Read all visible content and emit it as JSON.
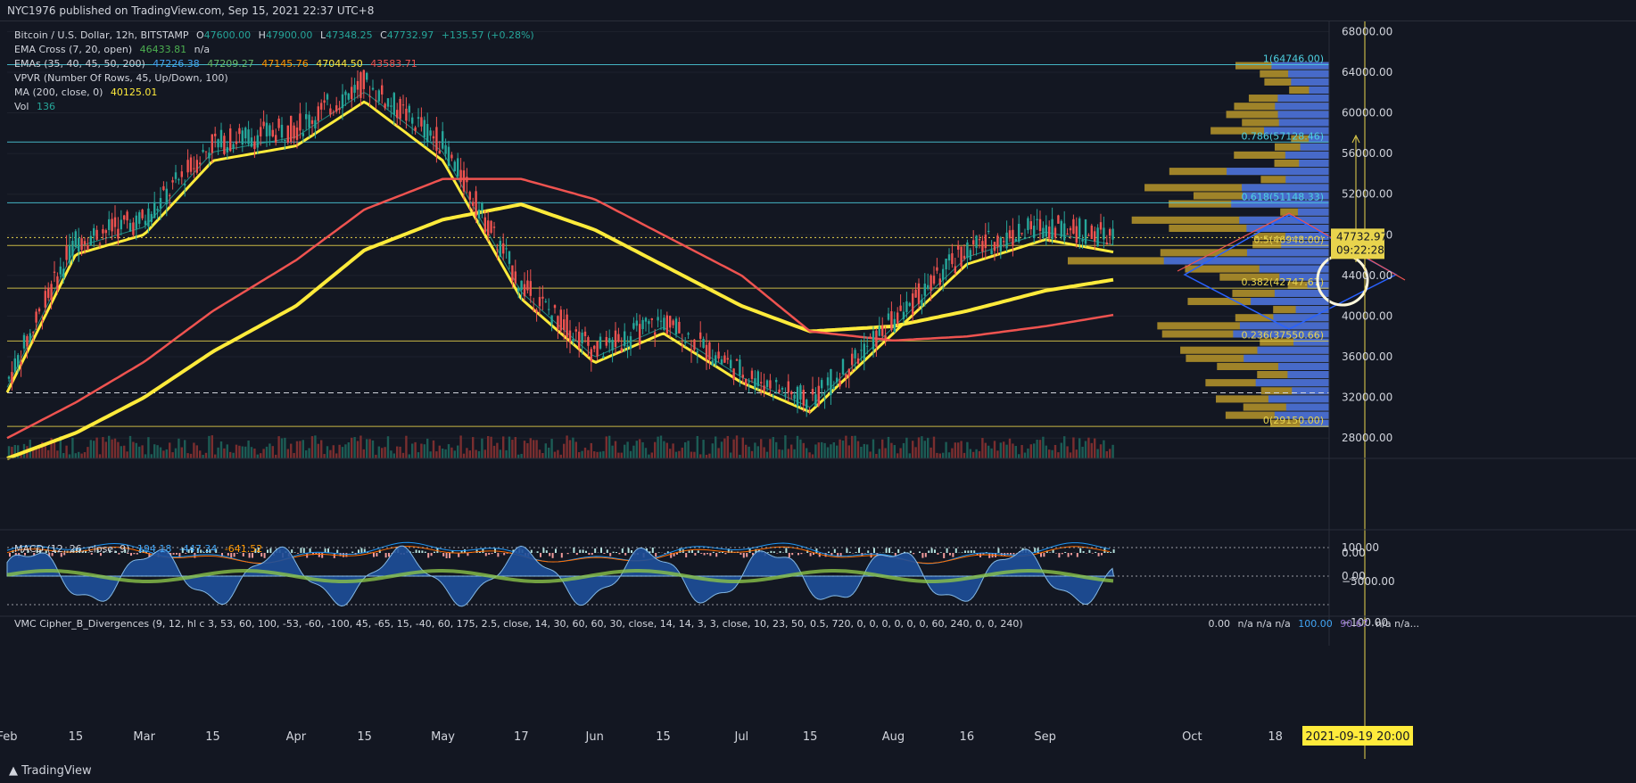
{
  "header": {
    "publisher_text": "NYC1976 published on TradingView.com, Sep 15, 2021 22:37 UTC+8"
  },
  "legend": {
    "symbol": "Bitcoin / U.S. Dollar, 12h, BITSTAMP",
    "ohlc": {
      "o_label": "O",
      "o": "47600.00",
      "h_label": "H",
      "h": "47900.00",
      "l_label": "L",
      "l": "47348.25",
      "c_label": "C",
      "c": "47732.97",
      "chg": "+135.57 (+0.28%)"
    },
    "ema_cross": {
      "label": "EMA Cross (7, 20, open)",
      "value": "46433.81",
      "na": "n/a"
    },
    "emas": {
      "label": "EMAs (35, 40, 45, 50, 200)",
      "values": [
        "47226.38",
        "47209.27",
        "47145.76",
        "47044.50",
        "43583.71"
      ]
    },
    "vpvr": {
      "label": "VPVR (Number Of Rows, 45, Up/Down, 100)"
    },
    "ma": {
      "label": "MA (200, close, 0)",
      "value": "40125.01"
    },
    "vol": {
      "label": "Vol",
      "value": "136"
    }
  },
  "macd_legend": {
    "label": "MACD (12, 26, close, 9)",
    "values": [
      "194.18",
      "-447.34",
      "-641.52"
    ]
  },
  "vmc_legend": {
    "label": "VMC Cipher_B_Divergences (9, 12, hl c 3, 53, 60, 100, -53, -60, -100, 45, -65, 15, -40, 60, 175, 2.5, close, 14, 30, 60, 60, 30, close, 14, 14, 3, 3, close, 10, 23, 50, 0.5, 720, 0, 0, 0, 0, 0, 0, 60, 240, 0, 0, 240)",
    "v1": "0.00",
    "v_na": "n/a n/a n/a",
    "v100": "100.00",
    "v9067": "90.67",
    "v_na2": "n/a n/a..."
  },
  "price_axis": {
    "labels": [
      "68000.00",
      "64000.00",
      "60000.00",
      "56000.00",
      "52000.00",
      "48000.00",
      "44000.00",
      "40000.00",
      "36000.00",
      "32000.00",
      "28000.00"
    ],
    "current_price": "47732.97",
    "countdown": "09:22:28"
  },
  "macd_axis": {
    "labels": [
      "0.00",
      "−5000.00"
    ]
  },
  "vmc_axis": {
    "labels": [
      "100.00",
      "0.00",
      "−100.00"
    ]
  },
  "time_axis": {
    "labels": [
      "Feb",
      "15",
      "Mar",
      "15",
      "Apr",
      "15",
      "May",
      "17",
      "Jun",
      "15",
      "Jul",
      "15",
      "Aug",
      "16",
      "Sep",
      "Oct",
      "18"
    ],
    "crosshair_label": "2021-09-19   20:00"
  },
  "fib": {
    "levels": [
      {
        "ratio": "1",
        "price": "64746.00"
      },
      {
        "ratio": "0.786",
        "price": "57128.46"
      },
      {
        "ratio": "0.618",
        "price": "51148.33"
      },
      {
        "ratio": "0.5",
        "price": "46948.00"
      },
      {
        "ratio": "0.382",
        "price": "42747.67"
      },
      {
        "ratio": "0.236",
        "price": "37550.66"
      },
      {
        "ratio": "0",
        "price": "29150.00"
      }
    ]
  },
  "colors": {
    "bg": "#131722",
    "up": "#26a69a",
    "down": "#ef5350",
    "ema_yellow": "#ffeb3b",
    "ma200": "#ef5350",
    "fib_line": "#4dd0e1",
    "vpvr_up": "#2962ff",
    "vpvr_down": "#b8962a",
    "grid": "#1e222d"
  },
  "chart_data": {
    "type": "line",
    "title": "Bitcoin / U.S. Dollar, 12h, BITSTAMP",
    "x": [
      "2021-02-01",
      "2021-02-15",
      "2021-03-01",
      "2021-03-15",
      "2021-04-01",
      "2021-04-15",
      "2021-05-01",
      "2021-05-17",
      "2021-06-01",
      "2021-06-15",
      "2021-07-01",
      "2021-07-15",
      "2021-08-01",
      "2021-08-16",
      "2021-09-01",
      "2021-09-15"
    ],
    "series": [
      {
        "name": "",
        "values": [
          33500,
          47500,
          49500,
          57000,
          58500,
          63000,
          57000,
          43000,
          36500,
          39500,
          34500,
          31500,
          39500,
          46500,
          49000,
          47733
        ]
      },
      {
        "name": "MA (200, close, 0)",
        "values": [
          28000,
          31500,
          35500,
          40500,
          45500,
          50500,
          53500,
          53500,
          51500,
          48000,
          44000,
          38500,
          37600,
          38000,
          39000,
          40125
        ]
      },
      {
        "name": "EMAs (35, 40, 45, 50, 200)",
        "values": [
          26000,
          28500,
          32000,
          36500,
          41000,
          46500,
          49500,
          51000,
          48500,
          45000,
          41000,
          38500,
          39000,
          40500,
          42500,
          43584
        ]
      }
    ],
    "ylim": [
      26000,
      69000
    ],
    "price_levels_dotted": [
      47732.97,
      32450
    ]
  }
}
